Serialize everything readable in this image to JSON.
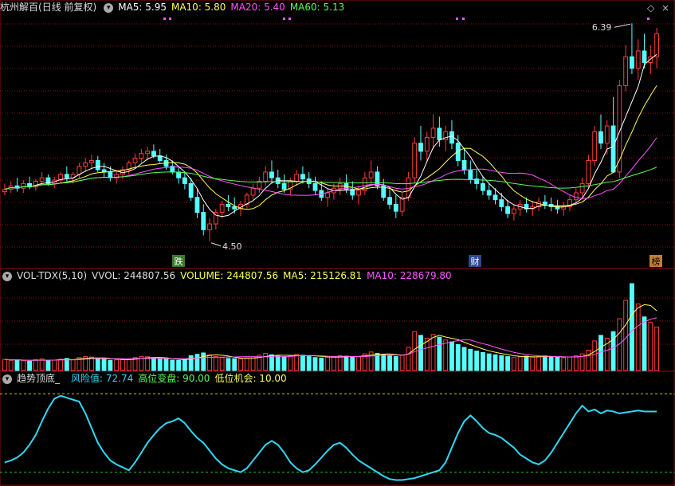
{
  "header": {
    "stock_name": "杭州解百",
    "period": "(日线 前复权)",
    "ma5": "MA5: 5.95",
    "ma10": "MA10: 5.80",
    "ma20": "MA20: 5.40",
    "ma60": "MA60: 5.13",
    "window_buttons": [
      "◇",
      "×"
    ]
  },
  "volume_header": {
    "indicator": "VOL-TDX(5,10)",
    "vvol": "VVOL: 244807.56",
    "volume": "VOLUME: 244807.56",
    "ma5": "MA5: 215126.81",
    "ma10": "MA10: 228679.80"
  },
  "indicator_header": {
    "name": "趋势顶底_",
    "risk": "风险值: 72.74",
    "high": "高位变盘: 90.00",
    "low": "低位机会: 10.00"
  },
  "annotations": {
    "high_label": "6.39",
    "low_label": "4.50",
    "tag_1": "跌",
    "tag_2": "财",
    "tag_3": "榜"
  },
  "colors": {
    "up": "#ff3b3b",
    "down": "#54ffff",
    "ma5": "#ffffff",
    "ma10": "#ffff55",
    "ma20": "#ff55ff",
    "ma60": "#55ff55",
    "vol_ma10": "#ff55ff",
    "indicator": "#30d8f5",
    "dashed_high": "#c8c820",
    "dashed_low": "#20c820",
    "grid": "#8b1010"
  },
  "chart_data": {
    "type": "candlestick",
    "price_high": 6.39,
    "price_low": 4.5,
    "last_volume": 244807.56,
    "volume_ma5": 215126.81,
    "volume_ma10": 228679.8,
    "indicator_last": 72.74,
    "indicator_high_line": 90.0,
    "indicator_low_line": 10.0,
    "ohlc": [
      [
        4.93,
        5.0,
        4.9,
        4.95
      ],
      [
        4.95,
        5.02,
        4.92,
        4.98
      ],
      [
        4.98,
        5.05,
        4.93,
        4.96
      ],
      [
        4.96,
        5.03,
        4.92,
        5.0
      ],
      [
        5.0,
        5.06,
        4.95,
        4.97
      ],
      [
        4.97,
        5.04,
        4.94,
        5.02
      ],
      [
        5.02,
        5.1,
        4.98,
        5.05
      ],
      [
        5.05,
        5.08,
        4.98,
        5.0
      ],
      [
        5.0,
        5.06,
        4.96,
        5.03
      ],
      [
        5.03,
        5.1,
        5.0,
        5.08
      ],
      [
        5.08,
        5.15,
        5.02,
        5.05
      ],
      [
        5.05,
        5.1,
        5.0,
        5.08
      ],
      [
        5.08,
        5.18,
        5.05,
        5.15
      ],
      [
        5.15,
        5.22,
        5.1,
        5.18
      ],
      [
        5.18,
        5.25,
        5.12,
        5.2
      ],
      [
        5.2,
        5.24,
        5.1,
        5.12
      ],
      [
        5.12,
        5.18,
        5.05,
        5.1
      ],
      [
        5.1,
        5.15,
        5.02,
        5.05
      ],
      [
        5.05,
        5.12,
        5.0,
        5.08
      ],
      [
        5.08,
        5.15,
        5.04,
        5.12
      ],
      [
        5.12,
        5.2,
        5.08,
        5.18
      ],
      [
        5.18,
        5.26,
        5.14,
        5.22
      ],
      [
        5.22,
        5.3,
        5.18,
        5.26
      ],
      [
        5.26,
        5.32,
        5.2,
        5.28
      ],
      [
        5.28,
        5.34,
        5.22,
        5.24
      ],
      [
        5.24,
        5.3,
        5.18,
        5.2
      ],
      [
        5.2,
        5.25,
        5.12,
        5.15
      ],
      [
        5.15,
        5.2,
        5.08,
        5.1
      ],
      [
        5.1,
        5.15,
        5.0,
        5.05
      ],
      [
        5.05,
        5.1,
        4.95,
        5.0
      ],
      [
        5.0,
        5.05,
        4.85,
        4.88
      ],
      [
        4.88,
        4.95,
        4.7,
        4.75
      ],
      [
        4.75,
        4.82,
        4.55,
        4.6
      ],
      [
        4.6,
        4.7,
        4.5,
        4.65
      ],
      [
        4.65,
        4.78,
        4.6,
        4.75
      ],
      [
        4.75,
        4.85,
        4.7,
        4.82
      ],
      [
        4.82,
        4.9,
        4.76,
        4.8
      ],
      [
        4.8,
        4.88,
        4.74,
        4.78
      ],
      [
        4.78,
        4.85,
        4.72,
        4.82
      ],
      [
        4.82,
        4.92,
        4.78,
        4.9
      ],
      [
        4.9,
        5.0,
        4.86,
        4.96
      ],
      [
        4.96,
        5.06,
        4.92,
        5.02
      ],
      [
        5.02,
        5.15,
        4.98,
        5.1
      ],
      [
        5.1,
        5.2,
        5.0,
        5.05
      ],
      [
        5.05,
        5.12,
        4.96,
        5.0
      ],
      [
        5.0,
        5.08,
        4.92,
        4.95
      ],
      [
        4.95,
        5.05,
        4.9,
        5.02
      ],
      [
        5.02,
        5.12,
        4.98,
        5.08
      ],
      [
        5.08,
        5.15,
        5.0,
        5.04
      ],
      [
        5.04,
        5.1,
        4.96,
        5.0
      ],
      [
        5.0,
        5.06,
        4.9,
        4.94
      ],
      [
        4.94,
        5.02,
        4.85,
        4.88
      ],
      [
        4.88,
        4.96,
        4.8,
        4.92
      ],
      [
        4.92,
        5.0,
        4.86,
        4.96
      ],
      [
        4.96,
        5.05,
        4.9,
        5.0
      ],
      [
        5.0,
        5.08,
        4.92,
        4.95
      ],
      [
        4.95,
        5.02,
        4.86,
        4.9
      ],
      [
        4.9,
        4.98,
        4.82,
        4.94
      ],
      [
        4.94,
        5.1,
        4.9,
        5.05
      ],
      [
        5.05,
        5.2,
        5.0,
        5.1
      ],
      [
        5.1,
        5.15,
        4.95,
        4.98
      ],
      [
        4.98,
        5.04,
        4.85,
        4.88
      ],
      [
        4.88,
        4.95,
        4.78,
        4.82
      ],
      [
        4.82,
        4.9,
        4.7,
        4.76
      ],
      [
        4.76,
        4.92,
        4.72,
        4.88
      ],
      [
        4.88,
        5.1,
        4.85,
        5.05
      ],
      [
        5.05,
        5.4,
        5.0,
        5.35
      ],
      [
        5.35,
        5.5,
        5.2,
        5.28
      ],
      [
        5.28,
        5.45,
        5.18,
        5.4
      ],
      [
        5.4,
        5.6,
        5.3,
        5.48
      ],
      [
        5.48,
        5.58,
        5.32,
        5.38
      ],
      [
        5.38,
        5.5,
        5.28,
        5.45
      ],
      [
        5.45,
        5.55,
        5.3,
        5.35
      ],
      [
        5.35,
        5.42,
        5.15,
        5.2
      ],
      [
        5.2,
        5.3,
        5.08,
        5.12
      ],
      [
        5.12,
        5.2,
        5.0,
        5.04
      ],
      [
        5.04,
        5.12,
        4.95,
        5.0
      ],
      [
        5.0,
        5.06,
        4.9,
        4.94
      ],
      [
        4.94,
        5.0,
        4.86,
        4.9
      ],
      [
        4.9,
        4.96,
        4.82,
        4.86
      ],
      [
        4.86,
        4.92,
        4.76,
        4.8
      ],
      [
        4.8,
        4.86,
        4.7,
        4.74
      ],
      [
        4.74,
        4.82,
        4.68,
        4.78
      ],
      [
        4.78,
        4.86,
        4.72,
        4.82
      ],
      [
        4.82,
        4.88,
        4.75,
        4.78
      ],
      [
        4.78,
        4.85,
        4.72,
        4.8
      ],
      [
        4.8,
        4.88,
        4.76,
        4.84
      ],
      [
        4.84,
        4.9,
        4.78,
        4.82
      ],
      [
        4.82,
        4.88,
        4.76,
        4.8
      ],
      [
        4.8,
        4.86,
        4.74,
        4.78
      ],
      [
        4.78,
        4.84,
        4.72,
        4.8
      ],
      [
        4.8,
        4.9,
        4.76,
        4.86
      ],
      [
        4.86,
        4.96,
        4.82,
        4.92
      ],
      [
        4.92,
        5.05,
        4.88,
        5.0
      ],
      [
        5.0,
        5.25,
        4.96,
        5.2
      ],
      [
        5.2,
        5.5,
        5.15,
        5.45
      ],
      [
        5.45,
        5.6,
        5.3,
        5.35
      ],
      [
        5.35,
        5.55,
        5.25,
        5.5
      ],
      [
        5.5,
        5.75,
        5.4,
        5.1
      ],
      [
        5.1,
        5.9,
        5.05,
        5.85
      ],
      [
        5.85,
        6.2,
        5.8,
        6.1
      ],
      [
        6.1,
        6.39,
        5.95,
        6.0
      ],
      [
        6.0,
        6.25,
        5.9,
        6.15
      ],
      [
        6.15,
        6.3,
        6.0,
        6.05
      ],
      [
        6.05,
        6.2,
        5.95,
        6.1
      ],
      [
        6.1,
        6.35,
        6.0,
        6.3
      ]
    ],
    "volume": [
      120,
      110,
      115,
      105,
      100,
      118,
      125,
      108,
      112,
      122,
      130,
      115,
      140,
      150,
      145,
      128,
      120,
      110,
      115,
      118,
      125,
      140,
      152,
      148,
      135,
      130,
      120,
      112,
      108,
      118,
      160,
      175,
      190,
      170,
      150,
      140,
      130,
      128,
      125,
      135,
      150,
      165,
      185,
      170,
      155,
      150,
      160,
      175,
      165,
      150,
      140,
      135,
      145,
      150,
      160,
      155,
      145,
      150,
      180,
      200,
      185,
      170,
      160,
      150,
      165,
      250,
      420,
      380,
      350,
      390,
      360,
      330,
      310,
      280,
      250,
      230,
      210,
      195,
      180,
      170,
      160,
      150,
      140,
      148,
      155,
      145,
      150,
      158,
      150,
      142,
      138,
      145,
      160,
      180,
      220,
      320,
      380,
      350,
      420,
      560,
      760,
      940,
      720,
      580,
      520,
      470
    ],
    "indicator": [
      20,
      22,
      25,
      30,
      38,
      48,
      62,
      75,
      85,
      88,
      86,
      84,
      82,
      70,
      55,
      40,
      30,
      22,
      18,
      15,
      12,
      20,
      30,
      40,
      48,
      55,
      60,
      62,
      65,
      60,
      52,
      45,
      40,
      32,
      24,
      18,
      14,
      12,
      10,
      14,
      22,
      30,
      38,
      42,
      38,
      30,
      20,
      14,
      10,
      12,
      18,
      25,
      32,
      38,
      40,
      35,
      28,
      22,
      18,
      14,
      10,
      6,
      3,
      2,
      2,
      3,
      4,
      6,
      8,
      10,
      12,
      20,
      35,
      50,
      62,
      68,
      62,
      55,
      50,
      48,
      45,
      40,
      35,
      28,
      24,
      20,
      18,
      22,
      30,
      40,
      50,
      60,
      70,
      78,
      72,
      74,
      70,
      73,
      72,
      70,
      71,
      72,
      73,
      72,
      72,
      72
    ]
  }
}
